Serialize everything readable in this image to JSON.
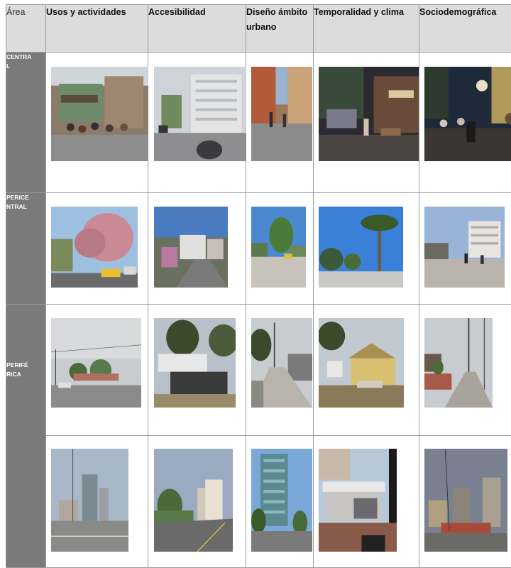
{
  "headers": {
    "area": "Área",
    "usos": "Usos y actividades",
    "accesibilidad": "Accesibilidad",
    "diseno": "Diseño ámbito urbano",
    "temporalidad": "Temporalidad y clima",
    "socio": "Sociodemográfica"
  },
  "rows": [
    {
      "area": "CENTRAL"
    },
    {
      "area": "PERICENTRAL"
    },
    {
      "area": "PERIFÉRICA"
    }
  ]
}
